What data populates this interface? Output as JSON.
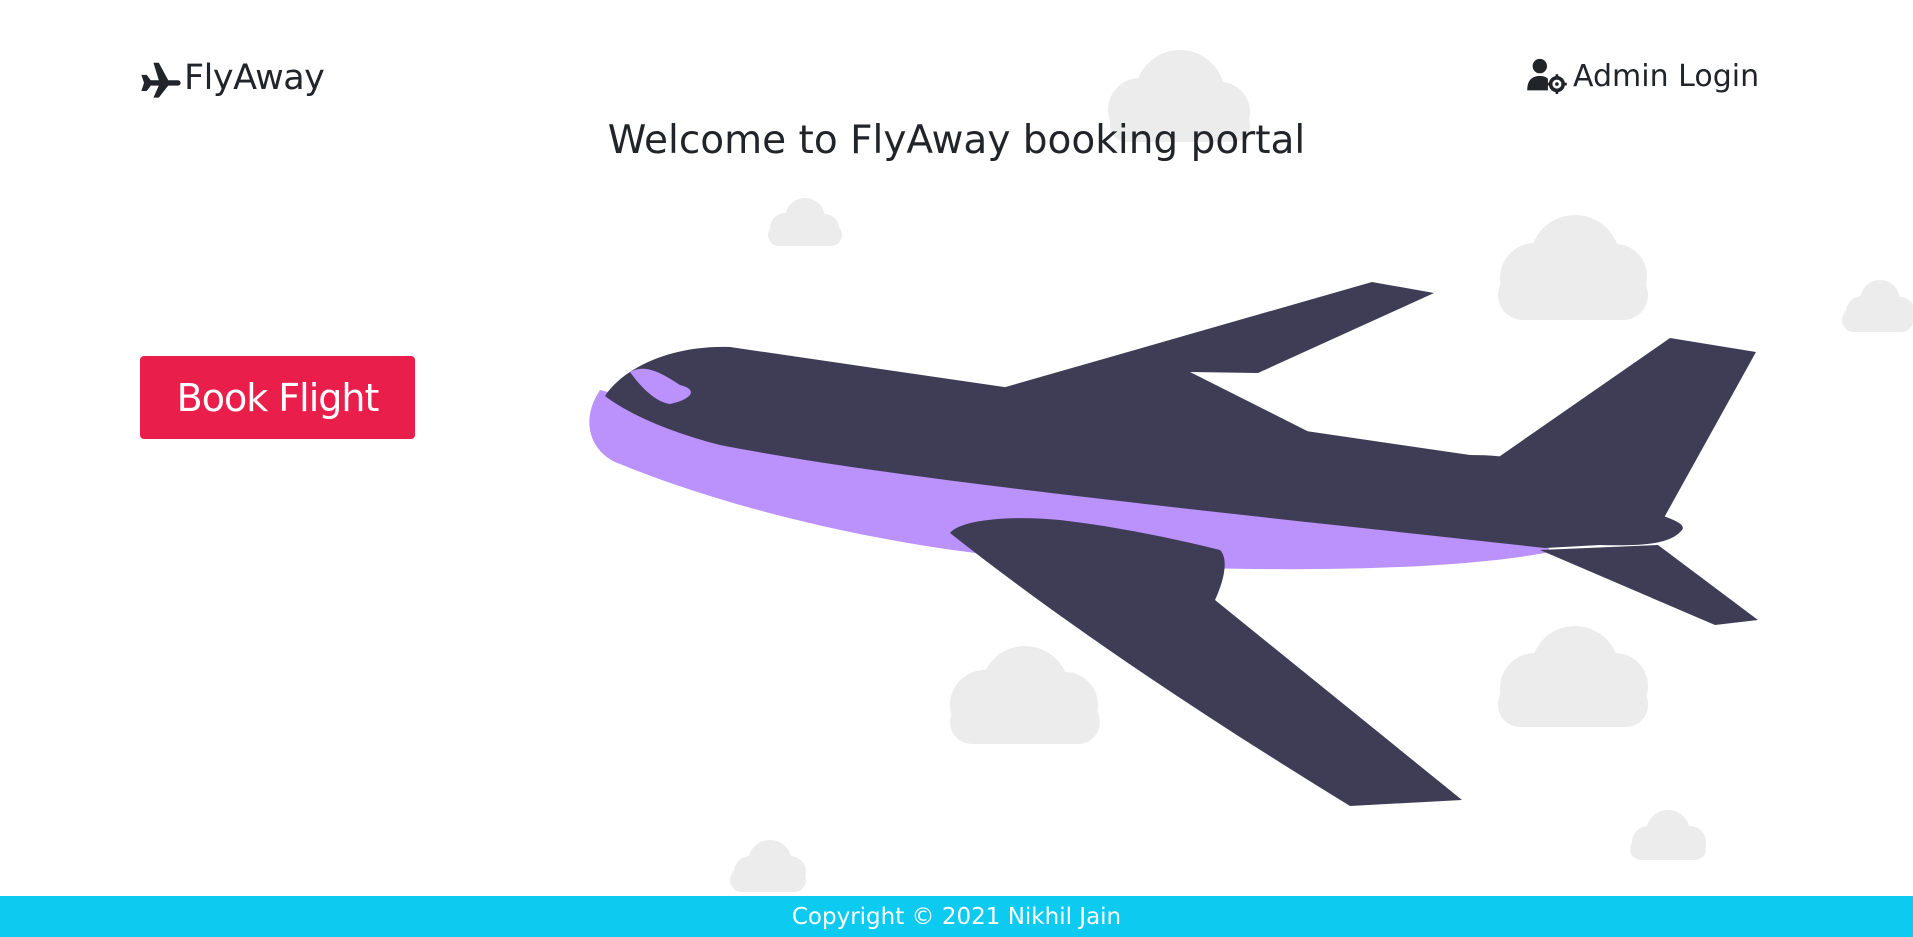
{
  "nav": {
    "brand": "FlyAway",
    "admin_login": "Admin Login"
  },
  "main": {
    "welcome": "Welcome to FlyAway booking portal",
    "book_flight": "Book Flight"
  },
  "footer": {
    "copyright": "Copyright © 2021 Nikhil Jain"
  },
  "icons": {
    "brand": "plane-icon",
    "admin": "user-gear-icon"
  },
  "colors": {
    "primary_button": "#e91e4b",
    "footer_bg": "#0dcaf0",
    "plane_body": "#3f3d56",
    "plane_stripe": "#bb91fc",
    "clouds": "#f2f2f2"
  }
}
